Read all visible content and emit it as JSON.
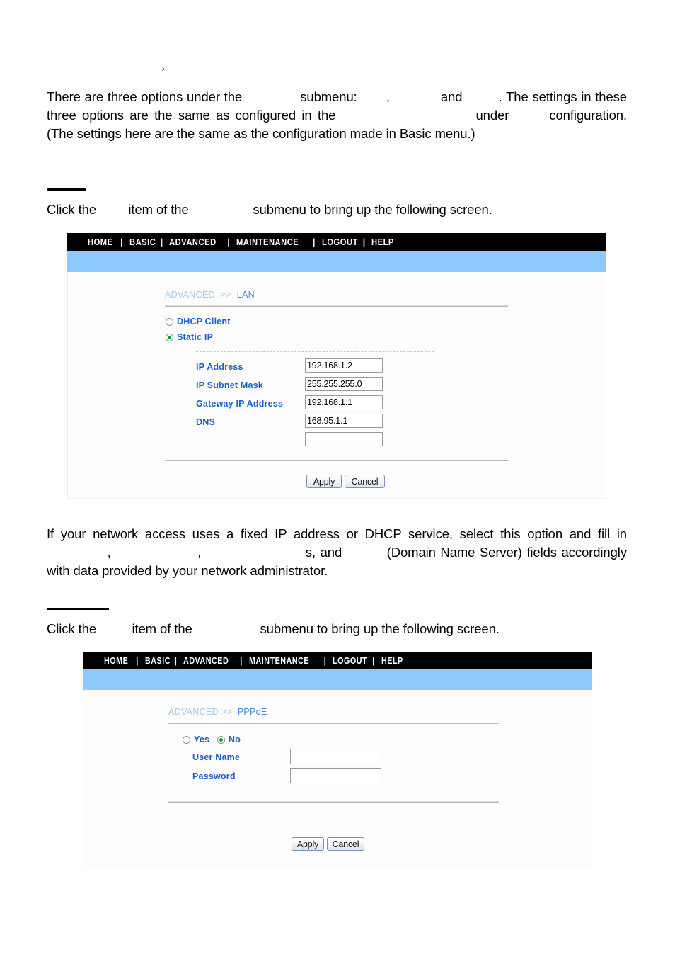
{
  "document": {
    "arrow_glyph": "→",
    "paragraphs": [
      {
        "id": "intro",
        "runs": [
          "There are three options under the ",
          "              ",
          " submenu: ",
          "       ",
          ", ",
          "            ",
          " and ",
          "         ",
          ". The settings in these three options are the same as configured in the ",
          "                                    ",
          " under ",
          "        ",
          " configuration. (The settings here are the same as the configuration made in Basic menu.)"
        ]
      },
      {
        "id": "lan-click",
        "runs": [
          "Click the ",
          "       ",
          " item of the ",
          "                ",
          " submenu to bring up the following screen."
        ]
      },
      {
        "id": "static-ip-desc",
        "runs": [
          "If your network access uses a fixed IP address or DHCP service, select this option and fill in ",
          "                 ",
          ", ",
          "                       ",
          ", ",
          "                            ",
          "s, and ",
          "          ",
          " (Domain Name Server) fields accordingly with data provided by your network administrator."
        ]
      },
      {
        "id": "pppoe-click",
        "runs": [
          "Click the ",
          "        ",
          " item of the ",
          "                 ",
          " submenu to bring up the following screen."
        ]
      }
    ]
  },
  "screenshot_lan": {
    "nav": {
      "items": [
        "HOME",
        "BASIC",
        "ADVANCED",
        "MAINTENANCE",
        "LOGOUT",
        "HELP"
      ],
      "separator": "|"
    },
    "breadcrumb": {
      "root": "ADVANCED",
      "separator": ">>",
      "leaf": "LAN"
    },
    "mode_radios": [
      {
        "label": "DHCP Client",
        "checked": false
      },
      {
        "label": "Static IP",
        "checked": true
      }
    ],
    "fields": [
      {
        "label": "IP Address",
        "value": "192.168.1.2"
      },
      {
        "label": "IP Subnet Mask",
        "value": "255.255.255.0"
      },
      {
        "label": "Gateway IP Address",
        "value": "192.168.1.1"
      },
      {
        "label": "DNS",
        "value": "168.95.1.1"
      },
      {
        "label": "",
        "value": ""
      }
    ],
    "buttons": {
      "apply": "Apply",
      "cancel": "Cancel"
    }
  },
  "screenshot_pppoe": {
    "nav": {
      "items": [
        "HOME",
        "BASIC",
        "ADVANCED",
        "MAINTENANCE",
        "LOGOUT",
        "HELP"
      ],
      "separator": "|"
    },
    "breadcrumb": {
      "root": "ADVANCED",
      "separator": ">>",
      "leaf": "PPPoE"
    },
    "enable_radios": [
      {
        "label": "Yes",
        "checked": false
      },
      {
        "label": "No",
        "checked": true
      }
    ],
    "fields": [
      {
        "label": "User Name",
        "value": ""
      },
      {
        "label": "Password",
        "value": ""
      }
    ],
    "buttons": {
      "apply": "Apply",
      "cancel": "Cancel"
    }
  },
  "colors": {
    "nav_background": "#000000",
    "blue_bar": "#8fc8fb",
    "label_blue": "#1a5fd0",
    "breadcrumb_leaf": "#4a86d8",
    "breadcrumb_root": "#a8c8ea",
    "radio_selected": "#17a01b"
  }
}
